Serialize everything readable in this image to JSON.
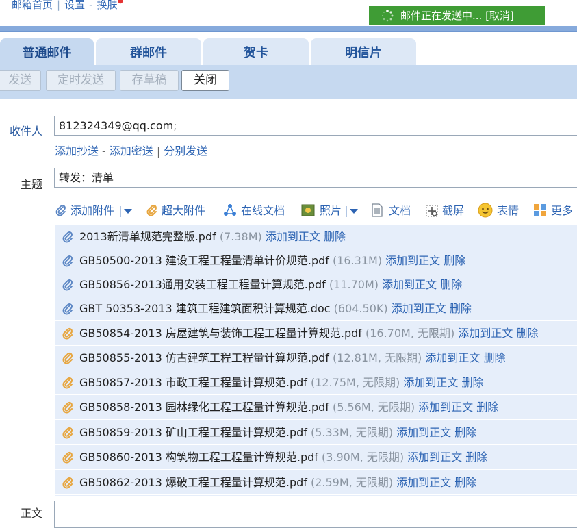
{
  "top_links": {
    "home": "邮箱首页",
    "settings": "设置",
    "skin": "换肤",
    "sep1": "|",
    "sep2": "-",
    "dot": "●"
  },
  "sending_banner": {
    "text": "邮件正在发送中... [取消]"
  },
  "tabs": [
    {
      "label": "普通邮件",
      "active": true
    },
    {
      "label": "群邮件",
      "active": false
    },
    {
      "label": "贺卡",
      "active": false
    },
    {
      "label": "明信片",
      "active": false
    }
  ],
  "toolbar": {
    "send": "发送",
    "scheduled_send": "定时发送",
    "save_draft": "存草稿",
    "close": "关闭"
  },
  "recipient": {
    "label": "收件人",
    "value": "812324349@qq.com",
    "separator": ";"
  },
  "recipient_links": {
    "add_cc": "添加抄送",
    "add_bcc": "添加密送",
    "separate_send": "分别发送",
    "sep1": "-",
    "sep2": "|"
  },
  "subject": {
    "label": "主题",
    "value": "转发：清单"
  },
  "attach_tools": {
    "add_attachment": "添加附件",
    "pipe": "|",
    "large_attachment": "超大附件",
    "online_doc": "在线文档",
    "photo": "照片",
    "document": "文档",
    "screenshot": "截屏",
    "emoji": "表情",
    "more": "更多"
  },
  "attachments": [
    {
      "name": "2013新清单规范完整版.pdf",
      "size": "(7.38M)",
      "add": "添加到正文",
      "del": "删除",
      "type": "normal"
    },
    {
      "name": "GB50500-2013 建设工程工程量清单计价规范.pdf",
      "size": "(16.31M)",
      "add": "添加到正文",
      "del": "删除",
      "type": "normal"
    },
    {
      "name": "GB50856-2013通用安装工程工程量计算规范.pdf",
      "size": "(11.70M)",
      "add": "添加到正文",
      "del": "删除",
      "type": "normal"
    },
    {
      "name": "GBT 50353-2013 建筑工程建筑面积计算规范.doc",
      "size": "(604.50K)",
      "add": "添加到正文",
      "del": "删除",
      "type": "normal"
    },
    {
      "name": "GB50854-2013 房屋建筑与装饰工程工程量计算规范.pdf",
      "size": "(16.70M, 无限期)",
      "add": "添加到正文",
      "del": "删除",
      "type": "large"
    },
    {
      "name": "GB50855-2013 仿古建筑工程工程量计算规范.pdf",
      "size": "(12.81M, 无限期)",
      "add": "添加到正文",
      "del": "删除",
      "type": "large"
    },
    {
      "name": "GB50857-2013 市政工程工程量计算规范.pdf",
      "size": "(12.75M, 无限期)",
      "add": "添加到正文",
      "del": "删除",
      "type": "large"
    },
    {
      "name": "GB50858-2013 园林绿化工程工程量计算规范.pdf",
      "size": "(5.56M, 无限期)",
      "add": "添加到正文",
      "del": "删除",
      "type": "large"
    },
    {
      "name": "GB50859-2013 矿山工程工程量计算规范.pdf",
      "size": "(5.33M, 无限期)",
      "add": "添加到正文",
      "del": "删除",
      "type": "large"
    },
    {
      "name": "GB50860-2013 构筑物工程工程量计算规范.pdf",
      "size": "(3.90M, 无限期)",
      "add": "添加到正文",
      "del": "删除",
      "type": "large"
    },
    {
      "name": "GB50862-2013 爆破工程工程量计算规范.pdf",
      "size": "(2.59M, 无限期)",
      "add": "添加到正文",
      "del": "删除",
      "type": "large"
    }
  ],
  "body": {
    "label": "正文"
  },
  "colors": {
    "accent_blue": "#2d64b3",
    "toolbar_bg": "#c6d9f0",
    "banner_green": "#3f9c35",
    "attach_bg": "#e6eefa",
    "clip_normal": "#5b86c4",
    "clip_large": "#e7a640"
  }
}
